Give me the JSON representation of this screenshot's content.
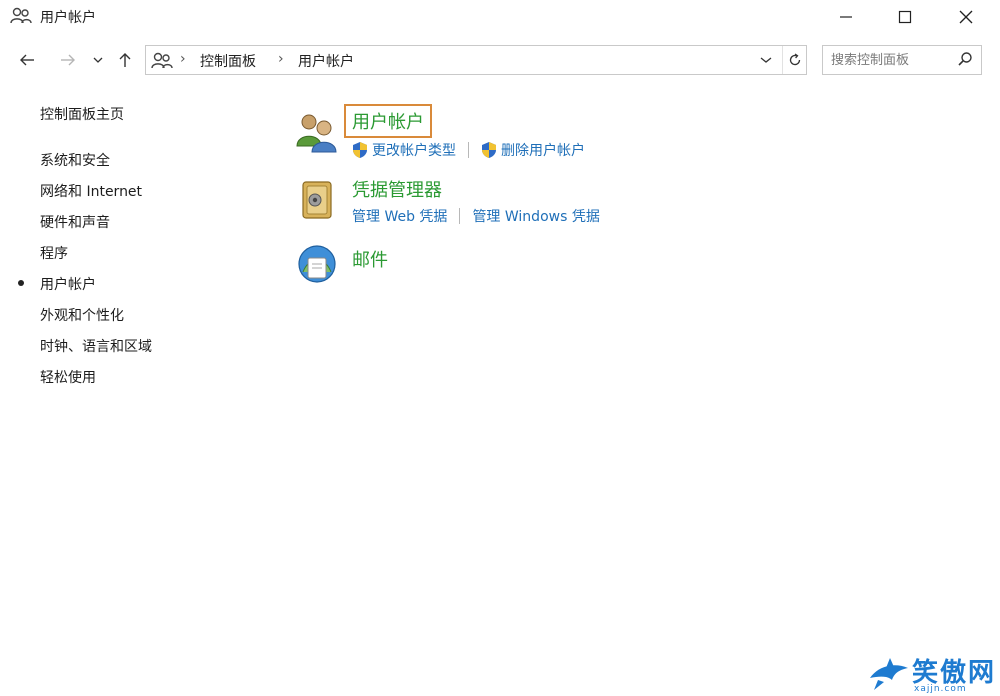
{
  "window": {
    "title": "用户帐户"
  },
  "navigation": {
    "breadcrumb": [
      "控制面板",
      "用户帐户"
    ],
    "breadcrumb_separator": "›",
    "search_placeholder": "搜索控制面板"
  },
  "sidebar": {
    "home": "控制面板主页",
    "items": [
      {
        "label": "系统和安全",
        "selected": false
      },
      {
        "label": "网络和 Internet",
        "selected": false
      },
      {
        "label": "硬件和声音",
        "selected": false
      },
      {
        "label": "程序",
        "selected": false
      },
      {
        "label": "用户帐户",
        "selected": true
      },
      {
        "label": "外观和个性化",
        "selected": false
      },
      {
        "label": "时钟、语言和区域",
        "selected": false
      },
      {
        "label": "轻松使用",
        "selected": false
      }
    ]
  },
  "categories": [
    {
      "title": "用户帐户",
      "icon": "users-icon",
      "highlighted": true,
      "links": [
        "更改帐户类型",
        "删除用户帐户"
      ]
    },
    {
      "title": "凭据管理器",
      "icon": "credential-vault-icon",
      "highlighted": false,
      "links": [
        "管理 Web 凭据",
        "管理 Windows 凭据"
      ]
    },
    {
      "title": "邮件",
      "icon": "mail-icon",
      "highlighted": false,
      "links": []
    }
  ],
  "watermark": {
    "text": "笑傲网",
    "sub": "xajjn.com"
  },
  "colors": {
    "category_title": "#2b9a33",
    "link": "#1f6fb8",
    "highlight_border": "#d98a3a",
    "watermark": "#1e7bd0"
  }
}
